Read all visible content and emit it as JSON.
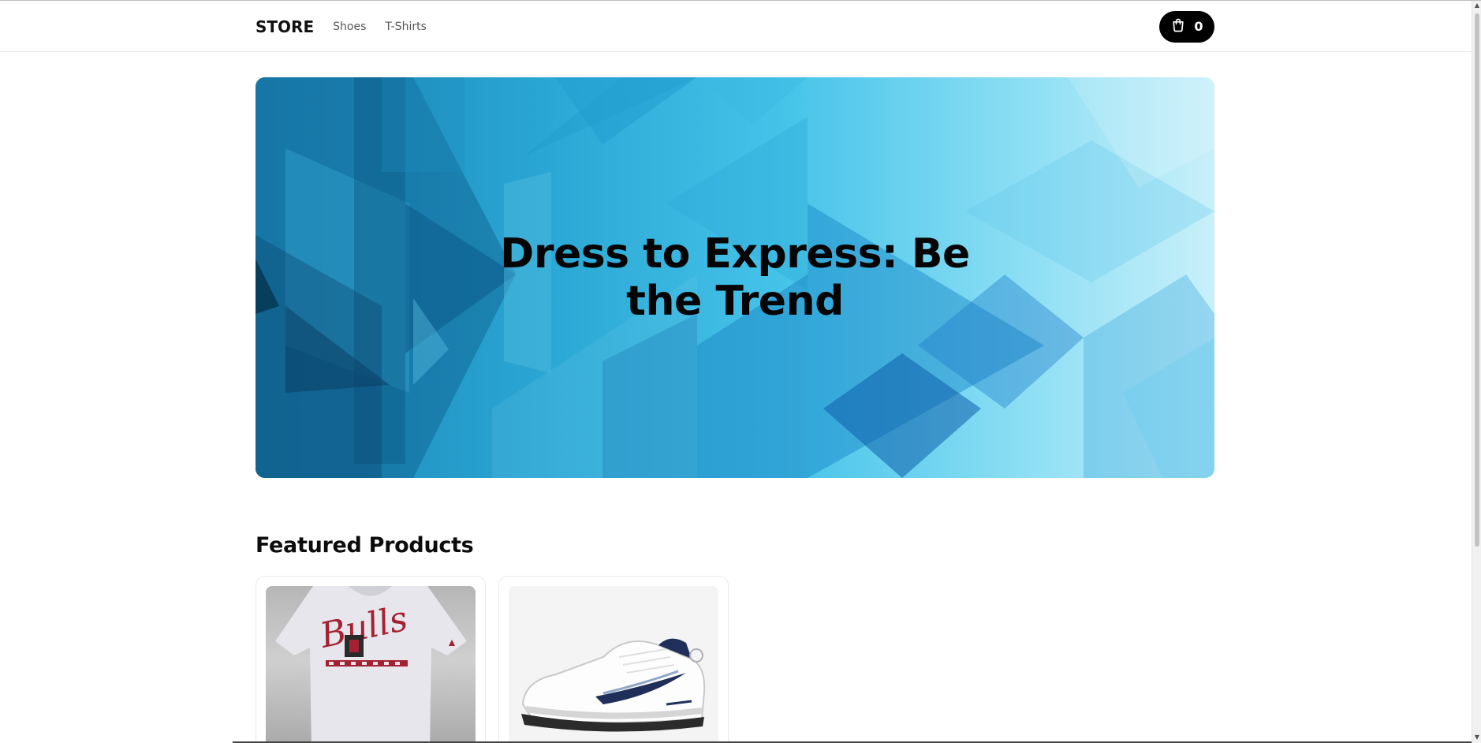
{
  "header": {
    "logo": "STORE",
    "nav": [
      {
        "label": "Shoes"
      },
      {
        "label": "T-Shirts"
      }
    ],
    "cart": {
      "icon": "shopping-bag-icon",
      "count": "0"
    }
  },
  "hero": {
    "title": "Dress to Express: Be the Trend"
  },
  "featured": {
    "title": "Featured Products",
    "products": [
      {
        "image": "bulls-tshirt",
        "logo_text": "Bulls"
      },
      {
        "image": "white-sneaker"
      }
    ]
  },
  "colors": {
    "accent": "#000000",
    "hero_gradient_start": "#1b86b6",
    "hero_gradient_end": "#c8f0fa"
  }
}
